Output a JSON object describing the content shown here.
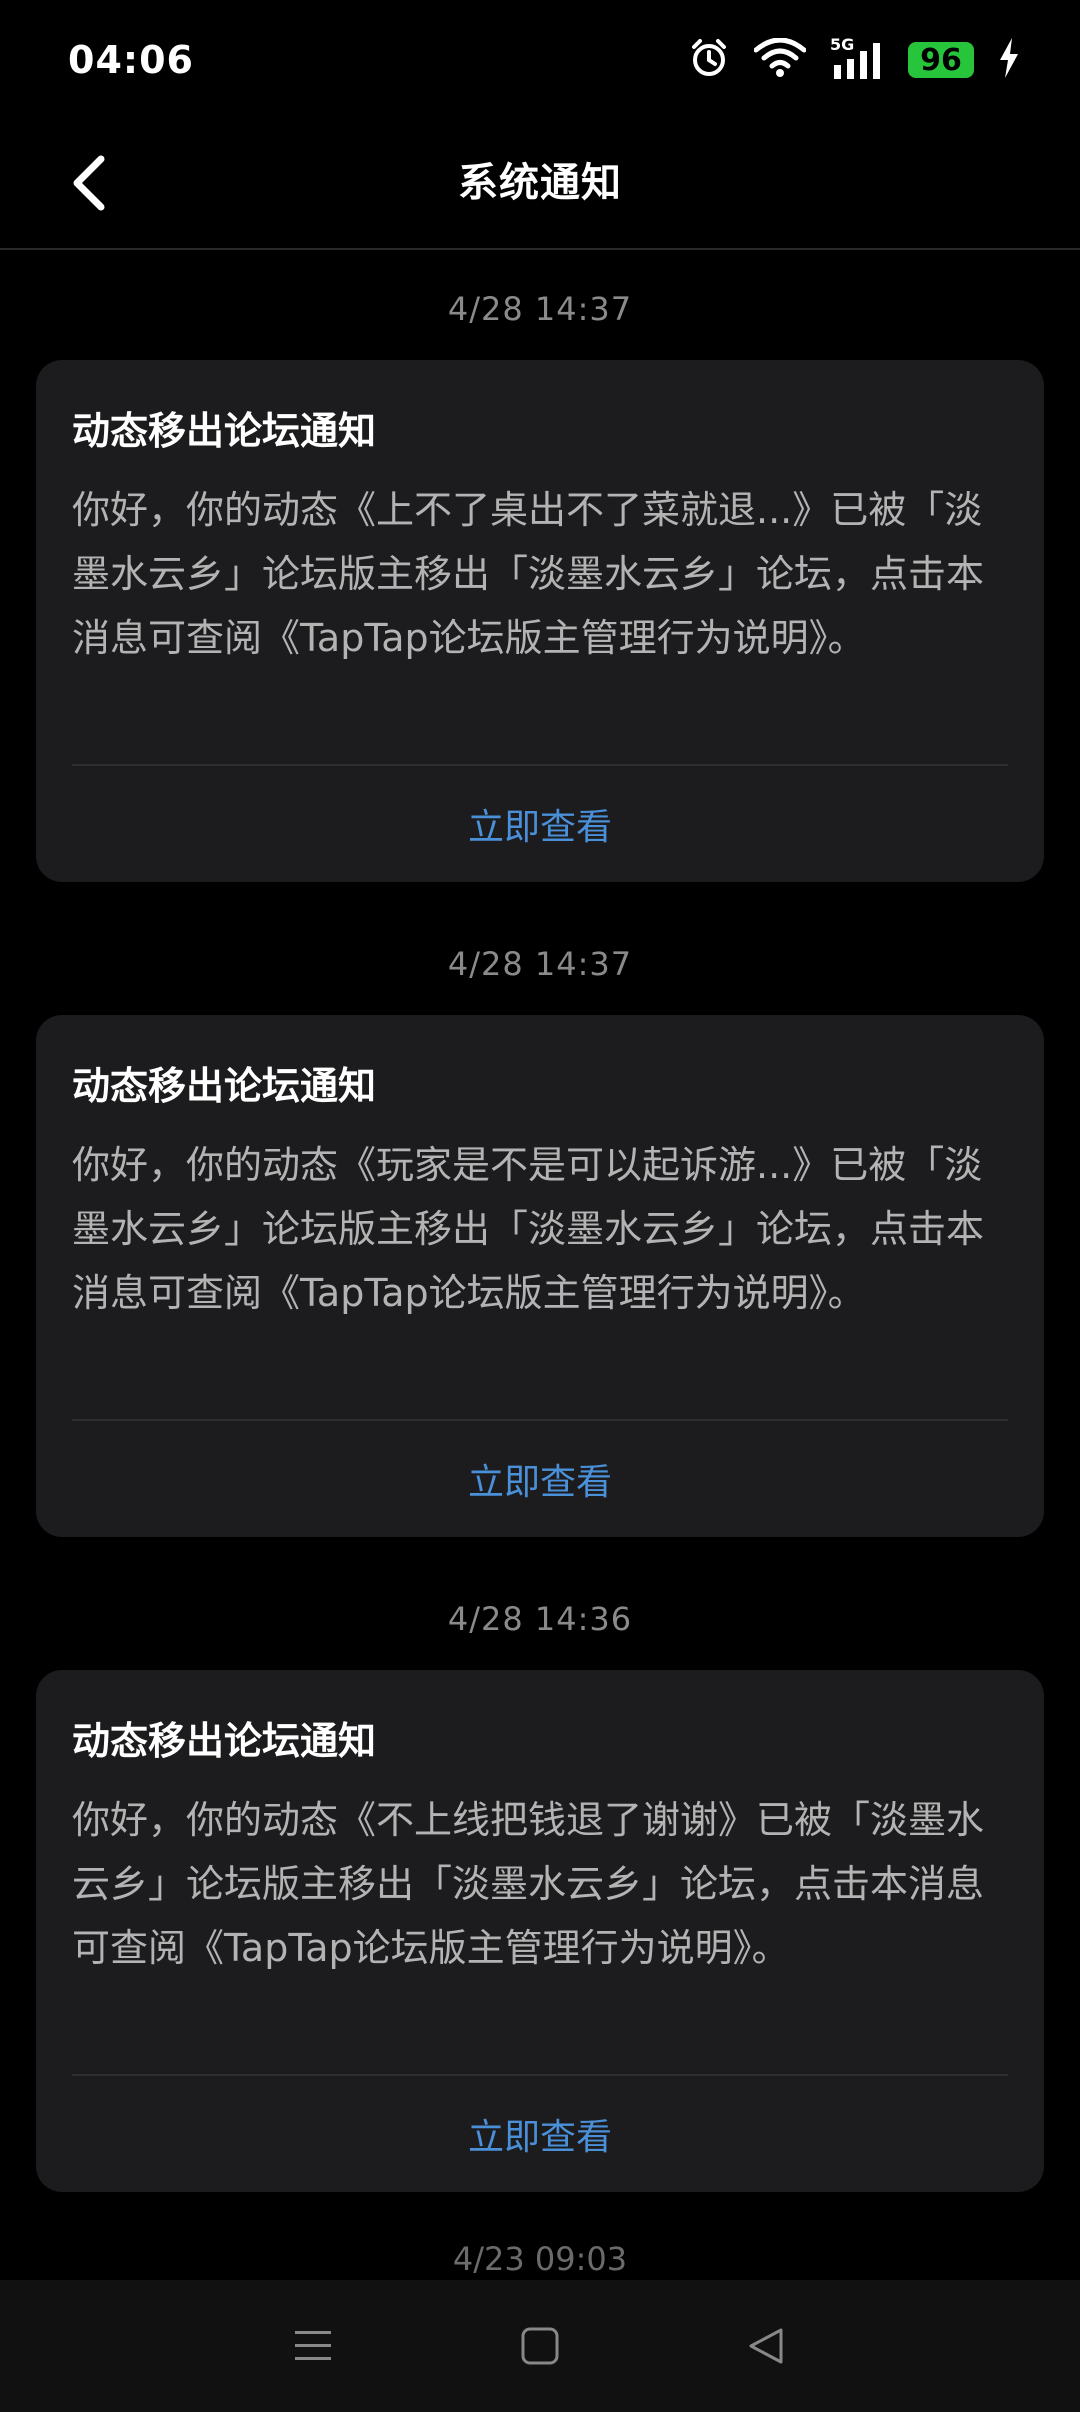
{
  "status_bar": {
    "time": "04:06",
    "network": "5G",
    "battery": "96",
    "icons": [
      "alarm-icon",
      "wifi-icon",
      "signal-icon",
      "battery-icon",
      "charging-icon"
    ]
  },
  "header": {
    "title": "系统通知",
    "back_icon": "chevron-left-icon"
  },
  "notifications": [
    {
      "time": "4/28  14:37",
      "title": "动态移出论坛通知",
      "body": "你好，你的动态《上不了桌出不了菜就退...》已被「淡墨水云乡」论坛版主移出「淡墨水云乡」论坛，点击本消息可查阅《TapTap论坛版主管理行为说明》。",
      "action": "立即查看"
    },
    {
      "time": "4/28  14:37",
      "title": "动态移出论坛通知",
      "body": "你好，你的动态《玩家是不是可以起诉游...》已被「淡墨水云乡」论坛版主移出「淡墨水云乡」论坛，点击本消息可查阅《TapTap论坛版主管理行为说明》。",
      "action": "立即查看"
    },
    {
      "time": "4/28  14:36",
      "title": "动态移出论坛通知",
      "body": "你好，你的动态《不上线把钱退了谢谢》已被「淡墨水云乡」论坛版主移出「淡墨水云乡」论坛，点击本消息可查阅《TapTap论坛版主管理行为说明》。",
      "action": "立即查看"
    }
  ],
  "partial_time": "4/23  09:03",
  "nav_bar": {
    "icons": [
      "menu-icon",
      "home-icon",
      "back-triangle-icon"
    ]
  },
  "colors": {
    "background": "#000000",
    "card": "#1c1c1e",
    "accent": "#4a90d9",
    "battery": "#27c53c"
  }
}
